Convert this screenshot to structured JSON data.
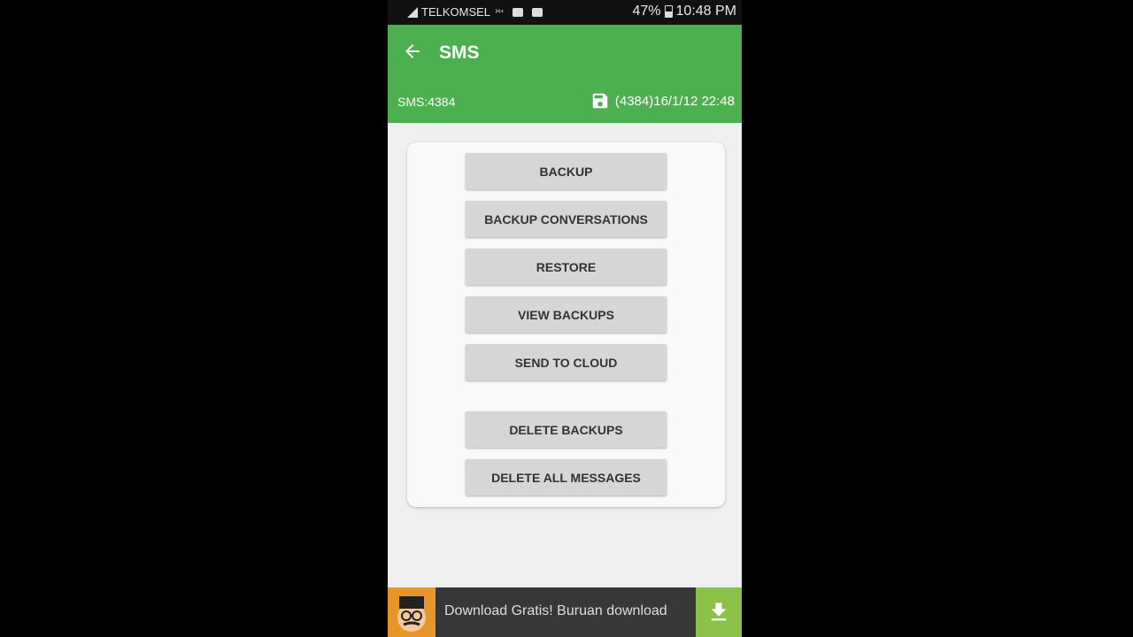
{
  "status_bar": {
    "carrier": "TELKOMSEL",
    "network_type": "H+",
    "battery_percent": "47%",
    "time": "10:48 PM",
    "icons": [
      "signal-icon",
      "video-call-icon",
      "message-icon",
      "battery-icon"
    ]
  },
  "app_bar": {
    "title": "SMS",
    "back_icon": "arrow-left-icon"
  },
  "info_bar": {
    "sms_count": "SMS:4384",
    "save_icon": "floppy-disk-icon",
    "last_backup": "(4384)16/1/12 22:48"
  },
  "actions": {
    "backup": "BACKUP",
    "backup_conversations": "BACKUP CONVERSATIONS",
    "restore": "RESTORE",
    "view_backups": "VIEW BACKUPS",
    "send_to_cloud": "SEND TO CLOUD",
    "delete_backups": "DELETE BACKUPS",
    "delete_all_messages": "DELETE ALL MESSAGES"
  },
  "ad": {
    "text": "Download Gratis! Buruan download",
    "download_icon": "download-icon"
  },
  "colors": {
    "app_bar": "#4cb050",
    "background": "#efefef",
    "button": "#d6d6d6",
    "ad_bar": "#373737",
    "ad_download": "#8bc34a"
  }
}
